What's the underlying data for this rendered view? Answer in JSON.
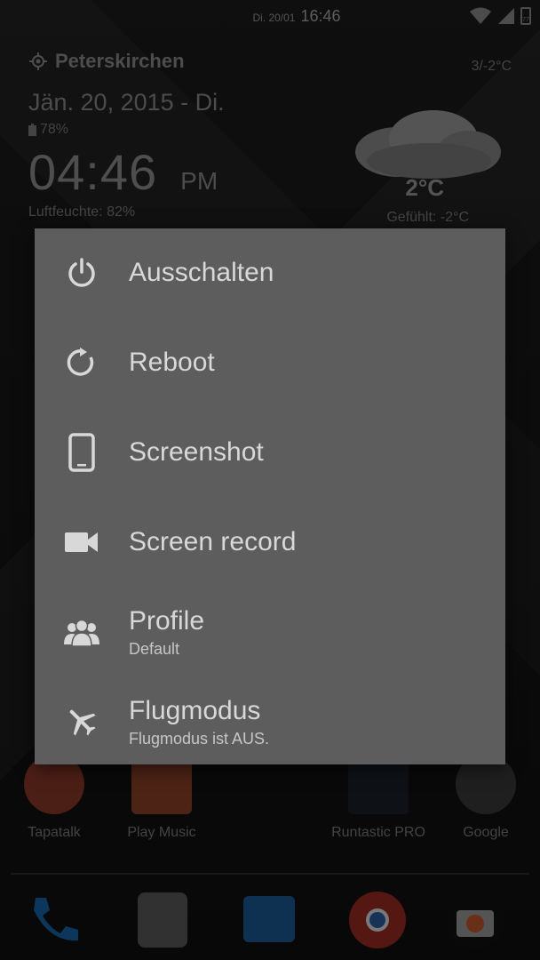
{
  "status_bar": {
    "date": "Di. 20/01",
    "time": "16:46",
    "battery": "77"
  },
  "widget": {
    "location": "Peterskirchen",
    "temp_range": "3/-2°C",
    "date_line": "Jän. 20, 2015 - Di.",
    "battery": "78%",
    "clock": "04:46",
    "ampm": "PM",
    "humidity": "Luftfeuchte: 82%",
    "temperature": "2°C",
    "feels_like": "Gefühlt: -2°C"
  },
  "power_menu": {
    "items": [
      {
        "label": "Ausschalten",
        "icon": "power-icon"
      },
      {
        "label": "Reboot",
        "icon": "reboot-icon"
      },
      {
        "label": "Screenshot",
        "icon": "phone-icon"
      },
      {
        "label": "Screen record",
        "icon": "video-camera-icon"
      },
      {
        "label": "Profile",
        "sub": "Default",
        "icon": "people-icon"
      },
      {
        "label": "Flugmodus",
        "sub": "Flugmodus ist AUS.",
        "icon": "airplane-icon"
      }
    ]
  },
  "apps": [
    {
      "label": "Tapatalk",
      "color": "#d1462b"
    },
    {
      "label": "Play Music",
      "color": "#e0572a"
    },
    {
      "label": "Runtastic PRO",
      "color": "#1f2a33"
    },
    {
      "label": "Google",
      "color": "#d44a38"
    }
  ],
  "dock": [
    {
      "icon": "phone-icon",
      "color": "#1e88e5"
    },
    {
      "icon": "email-robot-icon",
      "color": "#8a8a8a"
    },
    {
      "icon": "messaging-icon",
      "color": "#1e88e5"
    },
    {
      "icon": "chrome-icon",
      "color": "#e53935"
    },
    {
      "icon": "camera-icon",
      "color": "#e0e0e0"
    }
  ]
}
